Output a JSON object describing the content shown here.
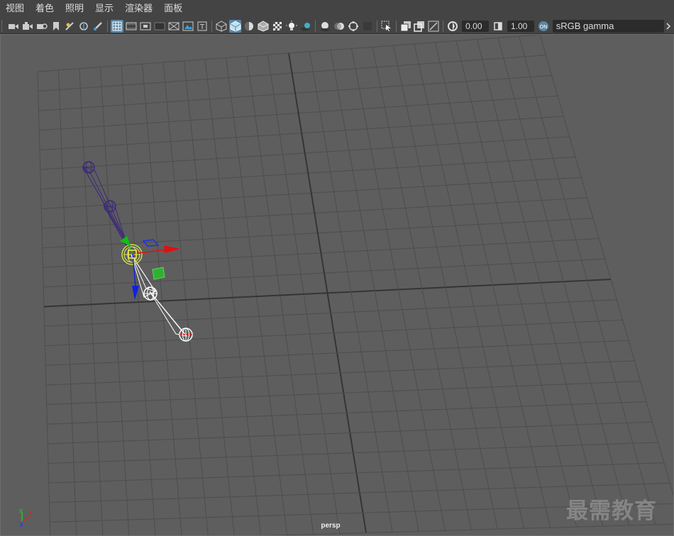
{
  "menubar": {
    "items": [
      {
        "label": "视图"
      },
      {
        "label": "着色"
      },
      {
        "label": "照明"
      },
      {
        "label": "显示"
      },
      {
        "label": "渲染器"
      },
      {
        "label": "面板"
      }
    ]
  },
  "toolbar": {
    "exposure_value": "0.00",
    "gamma_value": "1.00",
    "color_space": "sRGB gamma"
  },
  "viewport": {
    "camera_name": "persp",
    "watermark": "最需教育",
    "axis": {
      "x": "x",
      "y": "y",
      "z": "z"
    }
  },
  "colors": {
    "viewport_bg": "#5e5e5e",
    "grid_line": "#4d4d4d",
    "grid_axis": "#353535",
    "joint_selected": "#3c2a78",
    "joint_unselected": "#ffffff",
    "manip_x": "#e01010",
    "manip_y": "#10c010",
    "manip_z": "#1020e0",
    "highlight": "#5b87a5"
  }
}
